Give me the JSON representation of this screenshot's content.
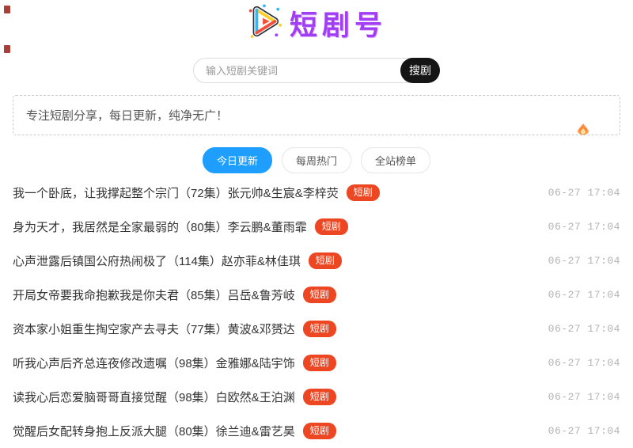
{
  "header": {
    "logo_text": "短剧号"
  },
  "search": {
    "placeholder": "输入短剧关键词",
    "button_label": "搜剧"
  },
  "notice": {
    "text": "专注短剧分享，每日更新，纯净无广！"
  },
  "tabs": [
    {
      "label": "今日更新",
      "active": true
    },
    {
      "label": "每周热门",
      "active": false
    },
    {
      "label": "全站榜单",
      "active": false
    }
  ],
  "badge_label": "短剧",
  "list": [
    {
      "title": "我一个卧底，让我撑起整个宗门（72集）张元帅&生宸&李梓荧",
      "date": "06-27 17:04"
    },
    {
      "title": "身为天才，我居然是全家最弱的（80集）李云鹏&董雨霏",
      "date": "06-27 17:04"
    },
    {
      "title": "心声泄露后镇国公府热闹极了（114集）赵亦菲&林佳琪",
      "date": "06-27 17:04"
    },
    {
      "title": "开局女帝要我命抱歉我是你夫君（85集）吕岳&鲁芳岐",
      "date": "06-27 17:04"
    },
    {
      "title": "资本家小姐重生掏空家产去寻夫（77集）黄波&邓赟达",
      "date": "06-27 17:04"
    },
    {
      "title": "听我心声后齐总连夜修改遗嘱（98集）金雅娜&陆宇饰",
      "date": "06-27 17:04"
    },
    {
      "title": "读我心后恋爱脑哥哥直接觉醒（98集）白欧然&王泊渊",
      "date": "06-27 17:04"
    },
    {
      "title": "觉醒后女配转身抱上反派大腿（80集）徐兰迪&雷艺昊",
      "date": "06-27 17:04"
    }
  ],
  "colors": {
    "accent_blue": "#1e9fff",
    "badge_red": "#ed4622",
    "logo_purple": "#a13df2",
    "date_gray": "#b3b3b3"
  }
}
